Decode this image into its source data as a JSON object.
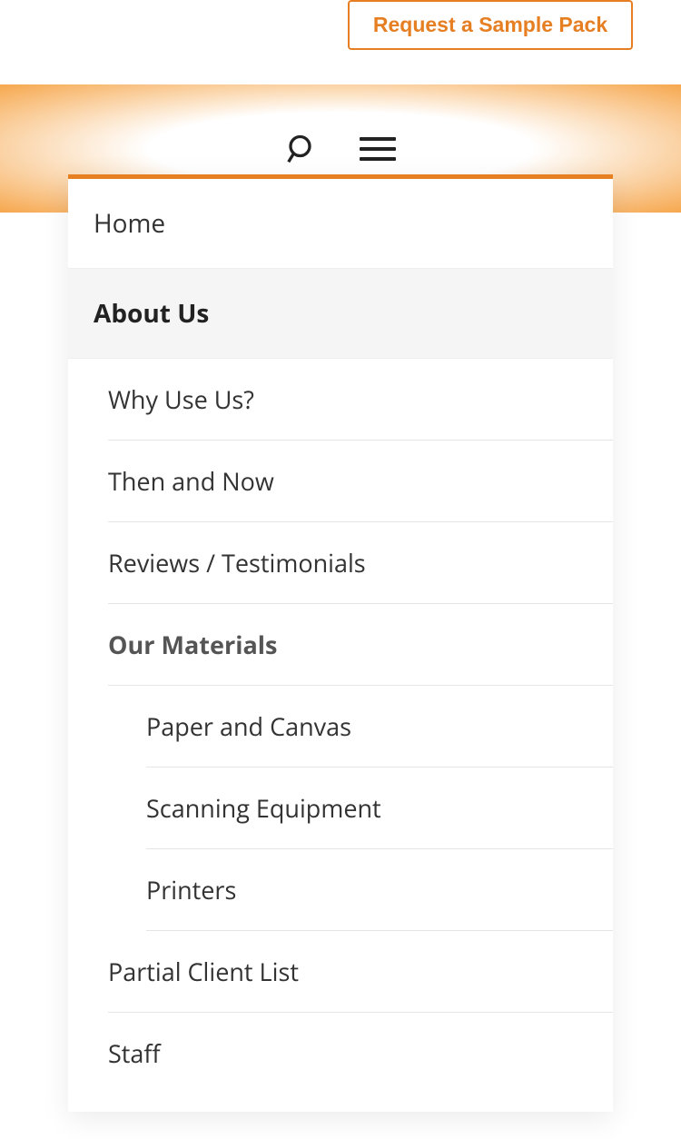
{
  "header": {
    "sample_pack_button": "Request a Sample Pack"
  },
  "nav": {
    "items": [
      {
        "label": "Home",
        "active": false
      },
      {
        "label": "About Us",
        "active": true
      }
    ],
    "about_subitems": [
      {
        "label": "Why Use Us?"
      },
      {
        "label": "Then and Now"
      },
      {
        "label": "Reviews / Testimonials"
      }
    ],
    "materials_heading": "Our Materials",
    "materials_subitems": [
      {
        "label": "Paper and Canvas"
      },
      {
        "label": "Scanning Equipment"
      },
      {
        "label": "Printers"
      }
    ],
    "about_subitems_after": [
      {
        "label": "Partial Client List"
      },
      {
        "label": "Staff"
      }
    ]
  }
}
